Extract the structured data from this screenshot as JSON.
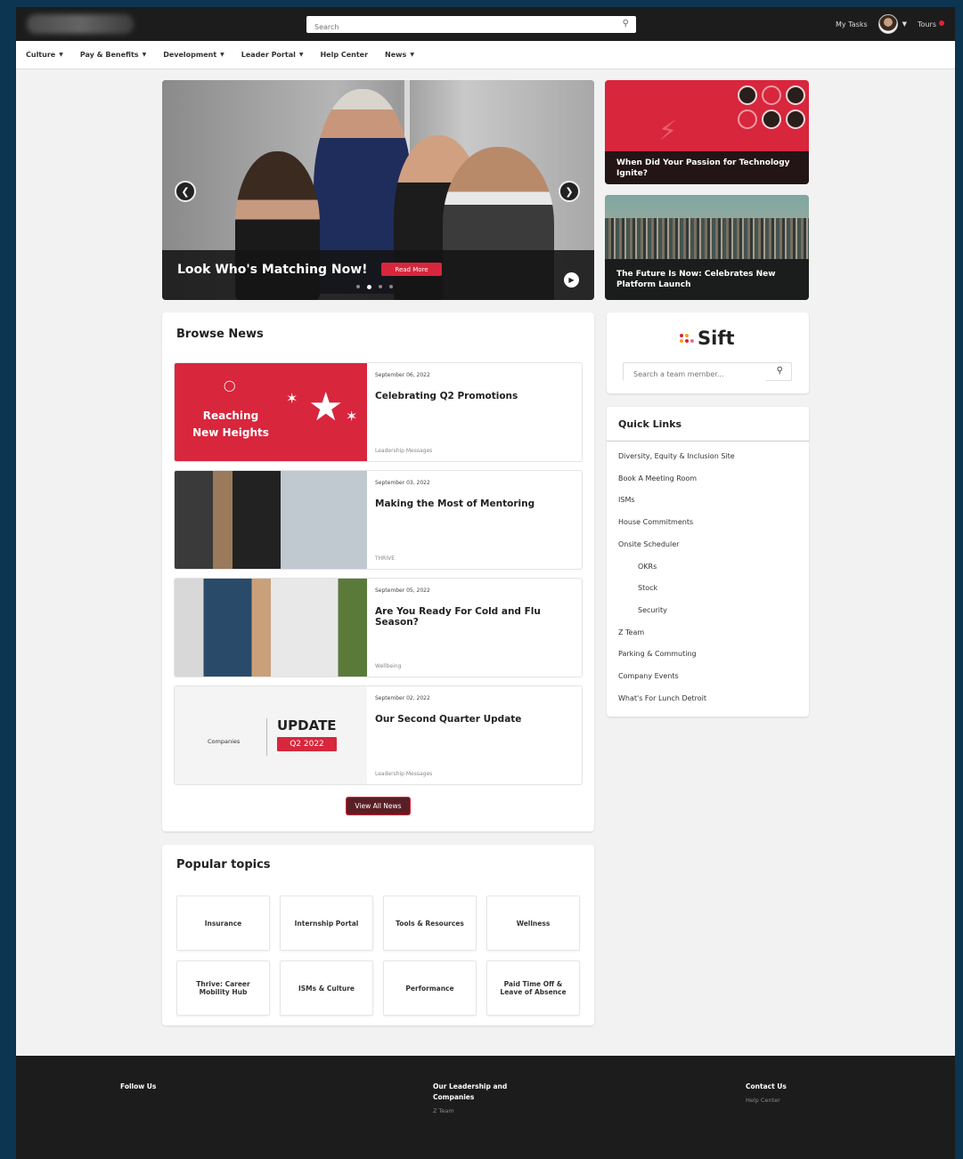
{
  "header": {
    "search_placeholder": "Search",
    "my_tasks": "My Tasks",
    "tours": "Tours"
  },
  "nav": {
    "items": [
      {
        "label": "Culture",
        "dropdown": true
      },
      {
        "label": "Pay & Benefits",
        "dropdown": true
      },
      {
        "label": "Development",
        "dropdown": true
      },
      {
        "label": "Leader Portal",
        "dropdown": true
      },
      {
        "label": "Help Center",
        "dropdown": false
      },
      {
        "label": "News",
        "dropdown": true
      }
    ]
  },
  "hero": {
    "title": "Look Who's Matching Now!",
    "button": "Read More",
    "slide_count": 4,
    "active_slide": 2
  },
  "promos": [
    {
      "title": "When Did Your Passion for Technology Ignite?"
    },
    {
      "title": "The Future Is Now: Celebrates New Platform Launch"
    }
  ],
  "browse_news": {
    "heading": "Browse News",
    "thumb_reaching": "Reaching New Heights",
    "thumb_update_company": "Companies",
    "thumb_update_title": "UPDATE",
    "thumb_update_quarter": "Q2 2022",
    "articles": [
      {
        "date": "September 06, 2022",
        "title": "Celebrating Q2 Promotions",
        "category": "Leadership Messages"
      },
      {
        "date": "September 03, 2022",
        "title": "Making the Most of Mentoring",
        "category": "THRIVE"
      },
      {
        "date": "September 05, 2022",
        "title": "Are You Ready For Cold and Flu Season?",
        "category": "Wellbeing"
      },
      {
        "date": "September 02, 2022",
        "title": "Our Second Quarter Update",
        "category": "Leadership Messages"
      }
    ],
    "view_all": "View All News"
  },
  "popular_topics": {
    "heading": "Popular topics",
    "items": [
      "Insurance",
      "Internship Portal",
      "Tools & Resources",
      "Wellness",
      "Thrive: Career Mobility Hub",
      "ISMs & Culture",
      "Performance",
      "Paid Time Off & Leave of Absence"
    ]
  },
  "sift": {
    "logo": "Sift",
    "placeholder": "Search a team member..."
  },
  "quick_links": {
    "heading": "Quick Links",
    "items": [
      "Diversity, Equity & Inclusion Site",
      "Book A Meeting Room",
      "ISMs",
      "House Commitments",
      "Onsite Scheduler",
      "OKRs",
      "Stock",
      "Security",
      "Z Team",
      "Parking & Commuting",
      "Company Events",
      "What's For Lunch Detroit"
    ]
  },
  "footer": {
    "follow_us": "Follow Us",
    "leadership": "Our Leadership and Companies",
    "leadership_link": "Z Team",
    "contact": "Contact Us",
    "contact_link": "Help Center"
  },
  "colors": {
    "brand_red": "#d8263c",
    "dark": "#1c1c1c",
    "page_bg": "#f2f2f2",
    "outer_bg": "#0b3550"
  }
}
